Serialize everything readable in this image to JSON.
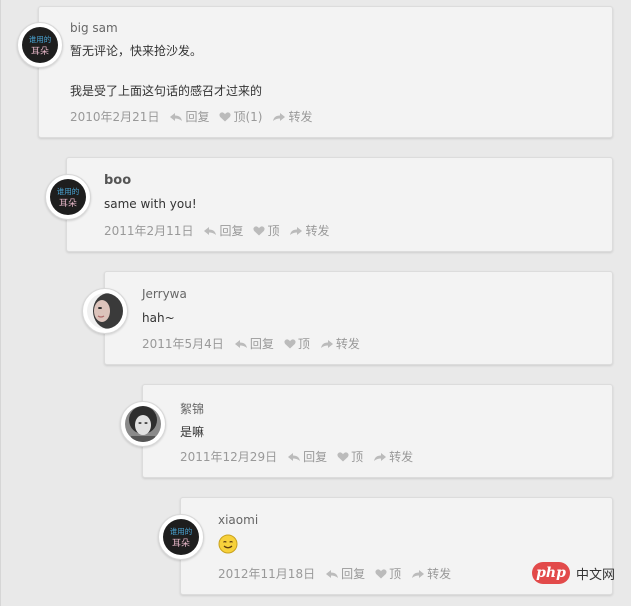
{
  "comments": [
    {
      "author": "big sam",
      "lines": [
        "暂无评论，快来抢沙发。",
        "我是受了上面这句话的感召才过来的"
      ],
      "date": "2010年2月21日",
      "reply": "回复",
      "like": "顶(1)",
      "forward": "转发",
      "avatar": "ears-logo-avatar"
    },
    {
      "author": "boo",
      "lines": [
        "same with you!"
      ],
      "date": "2011年2月11日",
      "reply": "回复",
      "like": "顶",
      "forward": "转发",
      "avatar": "ears-logo-avatar"
    },
    {
      "author": "Jerrywa",
      "lines": [
        "hah~"
      ],
      "date": "2011年5月4日",
      "reply": "回复",
      "like": "顶",
      "forward": "转发",
      "avatar": "portrait-photo-avatar"
    },
    {
      "author": "絮锦",
      "lines": [
        "是嘛"
      ],
      "date": "2011年12月29日",
      "reply": "回复",
      "like": "顶",
      "forward": "转发",
      "avatar": "portrait-photo-avatar"
    },
    {
      "author": "xiaomi",
      "lines": [],
      "emoji": "smile-emoji",
      "date": "2012年11月18日",
      "reply": "回复",
      "like": "顶",
      "forward": "转发",
      "avatar": "ears-logo-avatar"
    }
  ],
  "avatar_logo_text": [
    "谁用的",
    "耳朵"
  ],
  "watermark": {
    "logo": "php",
    "text": "中文网"
  }
}
